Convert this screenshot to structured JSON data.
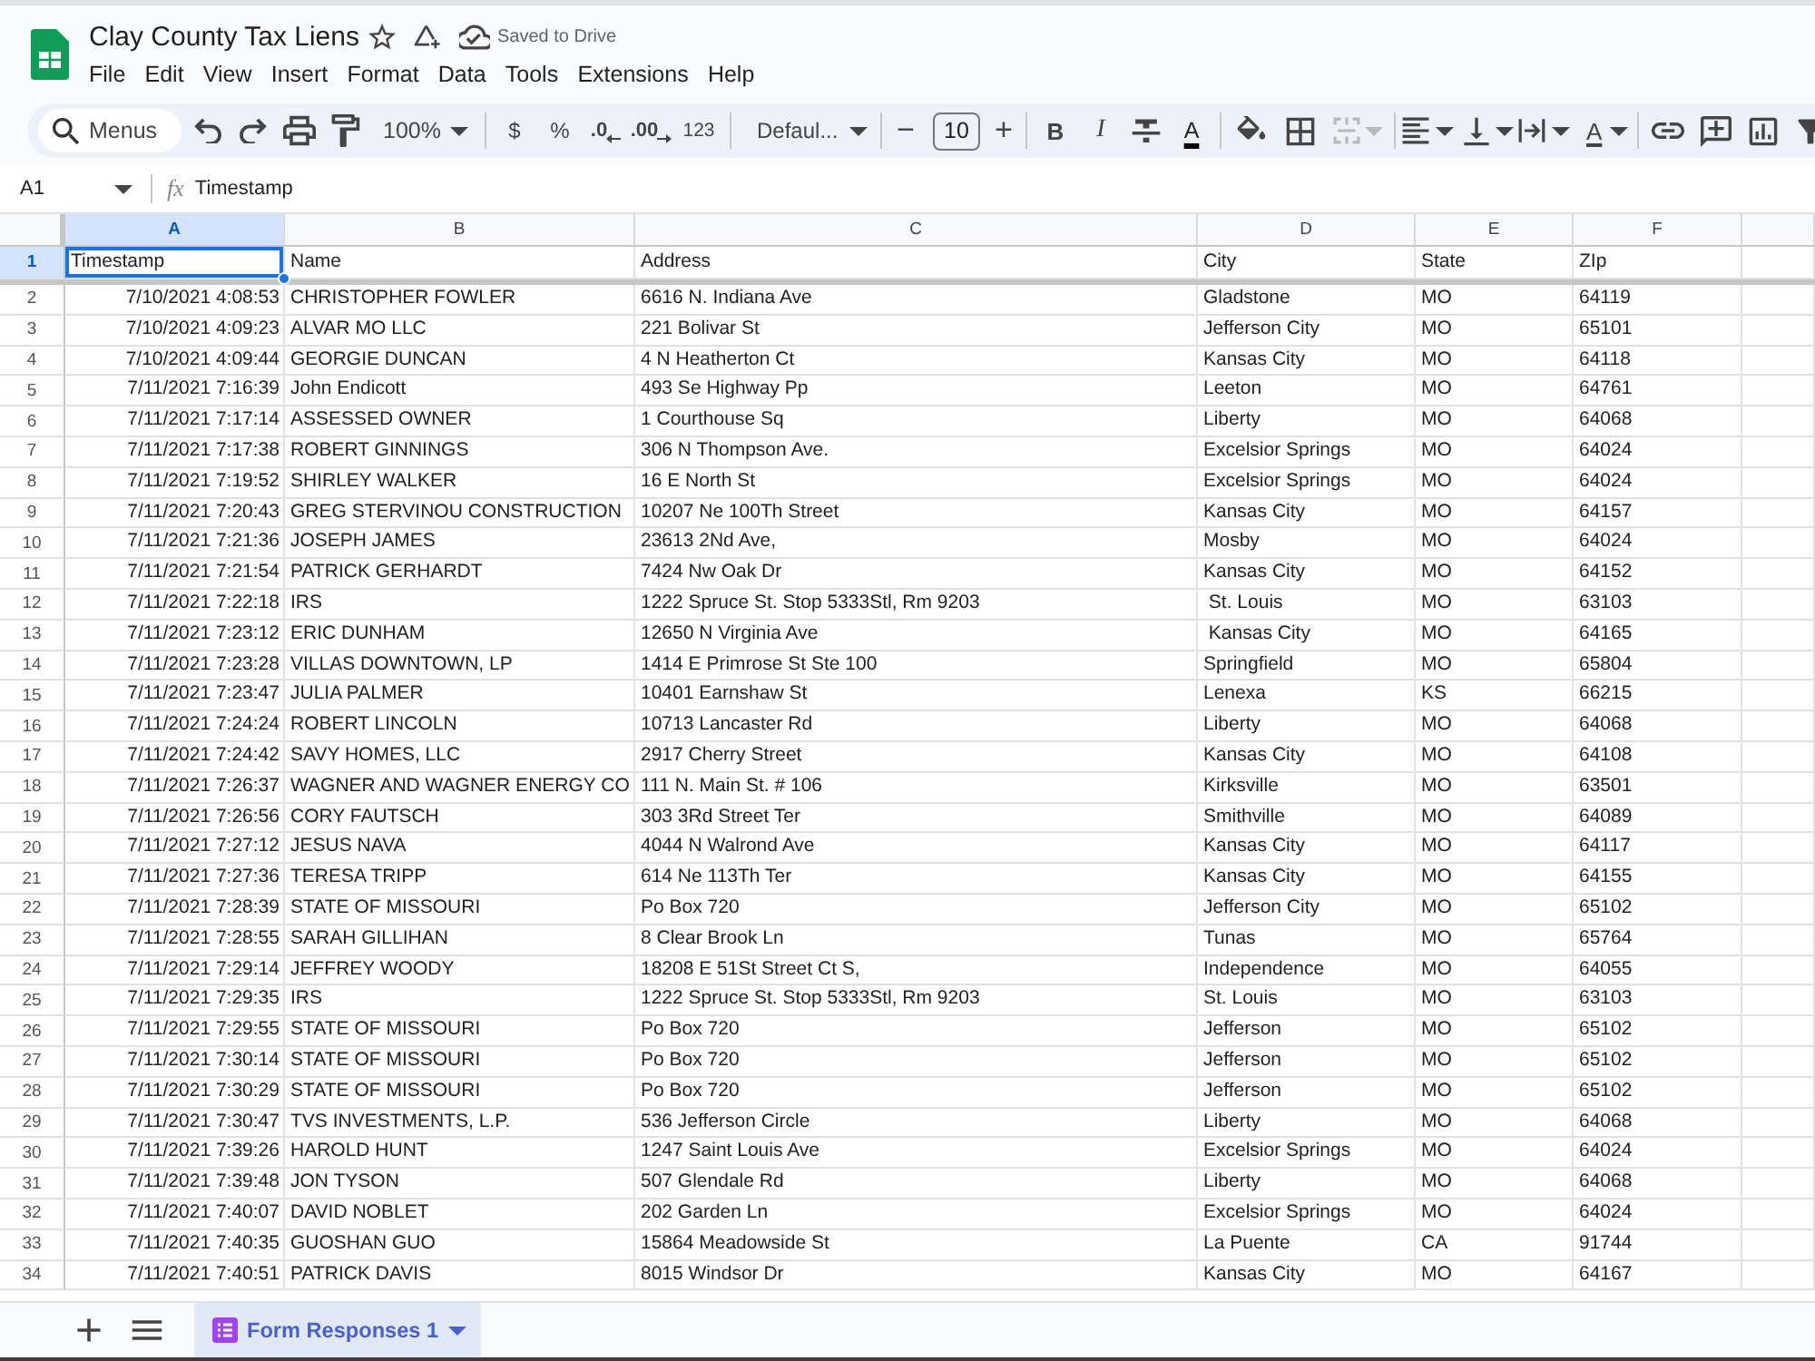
{
  "document": {
    "title": "Clay County Tax Liens",
    "save_status": "Saved to Drive"
  },
  "menu": [
    "File",
    "Edit",
    "View",
    "Insert",
    "Format",
    "Data",
    "Tools",
    "Extensions",
    "Help"
  ],
  "toolbar": {
    "search": {
      "placeholder": "Menus"
    },
    "zoom": "100%",
    "number_formats": [
      {
        "label": "$",
        "kind": "currency"
      },
      {
        "label": "%",
        "kind": "percent"
      },
      {
        "label": ".0",
        "kind": "decrease-decimal"
      },
      {
        "label": ".00",
        "kind": "increase-decimal"
      },
      {
        "label": "123",
        "kind": "more-formats"
      }
    ],
    "font": "Defaul...",
    "size_down": "−",
    "font_size": "10",
    "size_up": "+",
    "bold": "B",
    "italic": "I",
    "text_color": "A",
    "merge": {
      "disabled": true
    },
    "text_rotation": "A"
  },
  "formula_bar": {
    "cell_ref": "A1",
    "fx": "fx",
    "value": "Timestamp"
  },
  "sheet": {
    "columns": [
      {
        "label": "A",
        "selected": true
      },
      {
        "label": "B",
        "selected": false
      },
      {
        "label": "C",
        "selected": false
      },
      {
        "label": "D",
        "selected": false
      },
      {
        "label": "E",
        "selected": false
      },
      {
        "label": "F",
        "selected": false
      }
    ],
    "rows": [
      {
        "number": "1",
        "selected": true,
        "cells": [
          "Timestamp",
          "Name",
          "Address",
          "City",
          "State",
          "ZIp"
        ]
      },
      {
        "number": "2",
        "selected": false,
        "cells": [
          "7/10/2021 4:08:53",
          "CHRISTOPHER FOWLER",
          "6616 N. Indiana Ave",
          "Gladstone",
          "MO",
          "64119"
        ]
      },
      {
        "number": "3",
        "selected": false,
        "cells": [
          "7/10/2021 4:09:23",
          "ALVAR MO LLC",
          "221 Bolivar St",
          "Jefferson City",
          "MO",
          "65101"
        ]
      },
      {
        "number": "4",
        "selected": false,
        "cells": [
          "7/10/2021 4:09:44",
          "GEORGIE DUNCAN",
          "4 N Heatherton Ct",
          "Kansas City",
          "MO",
          "64118"
        ]
      },
      {
        "number": "5",
        "selected": false,
        "cells": [
          "7/11/2021 7:16:39",
          "John Endicott",
          "493 Se Highway Pp",
          "Leeton",
          "MO",
          "64761"
        ]
      },
      {
        "number": "6",
        "selected": false,
        "cells": [
          "7/11/2021 7:17:14",
          "ASSESSED OWNER",
          "1 Courthouse Sq",
          "Liberty",
          "MO",
          "64068"
        ]
      },
      {
        "number": "7",
        "selected": false,
        "cells": [
          "7/11/2021 7:17:38",
          "ROBERT GINNINGS",
          "306 N Thompson Ave.",
          "Excelsior Springs",
          "MO",
          "64024"
        ]
      },
      {
        "number": "8",
        "selected": false,
        "cells": [
          "7/11/2021 7:19:52",
          "SHIRLEY WALKER",
          "16 E North St",
          "Excelsior Springs",
          "MO",
          "64024"
        ]
      },
      {
        "number": "9",
        "selected": false,
        "cells": [
          "7/11/2021 7:20:43",
          "GREG STERVINOU CONSTRUCTION",
          "10207 Ne 100Th Street",
          "Kansas City",
          "MO",
          "64157"
        ]
      },
      {
        "number": "10",
        "selected": false,
        "cells": [
          "7/11/2021 7:21:36",
          "JOSEPH JAMES",
          "23613 2Nd Ave,",
          "Mosby",
          "MO",
          "64024"
        ]
      },
      {
        "number": "11",
        "selected": false,
        "cells": [
          "7/11/2021 7:21:54",
          "PATRICK GERHARDT",
          "7424 Nw Oak Dr",
          "Kansas City",
          "MO",
          "64152"
        ]
      },
      {
        "number": "12",
        "selected": false,
        "cells": [
          "7/11/2021 7:22:18",
          "IRS",
          "1222 Spruce St. Stop 5333Stl, Rm 9203",
          " St. Louis",
          "MO",
          "63103"
        ]
      },
      {
        "number": "13",
        "selected": false,
        "cells": [
          "7/11/2021 7:23:12",
          "ERIC DUNHAM",
          "12650 N Virginia Ave",
          " Kansas City",
          "MO",
          "64165"
        ]
      },
      {
        "number": "14",
        "selected": false,
        "cells": [
          "7/11/2021 7:23:28",
          "VILLAS DOWNTOWN, LP",
          "1414 E Primrose St Ste 100",
          "Springfield",
          "MO",
          "65804"
        ]
      },
      {
        "number": "15",
        "selected": false,
        "cells": [
          "7/11/2021 7:23:47",
          "JULIA PALMER",
          "10401 Earnshaw St",
          "Lenexa",
          "KS",
          "66215"
        ]
      },
      {
        "number": "16",
        "selected": false,
        "cells": [
          "7/11/2021 7:24:24",
          "ROBERT LINCOLN",
          "10713 Lancaster Rd",
          "Liberty",
          "MO",
          "64068"
        ]
      },
      {
        "number": "17",
        "selected": false,
        "cells": [
          "7/11/2021 7:24:42",
          "SAVY HOMES, LLC",
          "2917 Cherry Street",
          "Kansas City",
          "MO",
          "64108"
        ]
      },
      {
        "number": "18",
        "selected": false,
        "cells": [
          "7/11/2021 7:26:37",
          "WAGNER AND WAGNER ENERGY CO",
          "111 N. Main St. # 106",
          "Kirksville",
          "MO",
          "63501"
        ]
      },
      {
        "number": "19",
        "selected": false,
        "cells": [
          "7/11/2021 7:26:56",
          "CORY FAUTSCH",
          "303 3Rd Street Ter",
          "Smithville",
          "MO",
          "64089"
        ]
      },
      {
        "number": "20",
        "selected": false,
        "cells": [
          "7/11/2021 7:27:12",
          "JESUS NAVA",
          "4044 N Walrond Ave",
          "Kansas City",
          "MO",
          "64117"
        ]
      },
      {
        "number": "21",
        "selected": false,
        "cells": [
          "7/11/2021 7:27:36",
          "TERESA TRIPP",
          "614 Ne 113Th Ter",
          "Kansas City",
          "MO",
          "64155"
        ]
      },
      {
        "number": "22",
        "selected": false,
        "cells": [
          "7/11/2021 7:28:39",
          "STATE OF MISSOURI",
          "Po Box 720",
          "Jefferson City",
          "MO",
          "65102"
        ]
      },
      {
        "number": "23",
        "selected": false,
        "cells": [
          "7/11/2021 7:28:55",
          "SARAH GILLIHAN",
          "8 Clear Brook Ln",
          "Tunas",
          "MO",
          "65764"
        ]
      },
      {
        "number": "24",
        "selected": false,
        "cells": [
          "7/11/2021 7:29:14",
          "JEFFREY WOODY",
          "18208 E 51St Street Ct S,",
          "Independence",
          "MO",
          "64055"
        ]
      },
      {
        "number": "25",
        "selected": false,
        "cells": [
          "7/11/2021 7:29:35",
          "IRS",
          "1222 Spruce St. Stop 5333Stl, Rm 9203",
          "St. Louis",
          "MO",
          "63103"
        ]
      },
      {
        "number": "26",
        "selected": false,
        "cells": [
          "7/11/2021 7:29:55",
          "STATE OF MISSOURI",
          "Po Box 720",
          "Jefferson",
          "MO",
          "65102"
        ]
      },
      {
        "number": "27",
        "selected": false,
        "cells": [
          "7/11/2021 7:30:14",
          "STATE OF MISSOURI",
          "Po Box 720",
          "Jefferson",
          "MO",
          "65102"
        ]
      },
      {
        "number": "28",
        "selected": false,
        "cells": [
          "7/11/2021 7:30:29",
          "STATE OF MISSOURI",
          "Po Box 720",
          "Jefferson",
          "MO",
          "65102"
        ]
      },
      {
        "number": "29",
        "selected": false,
        "cells": [
          "7/11/2021 7:30:47",
          "TVS INVESTMENTS, L.P.",
          "536 Jefferson Circle",
          "Liberty",
          "MO",
          "64068"
        ]
      },
      {
        "number": "30",
        "selected": false,
        "cells": [
          "7/11/2021 7:39:26",
          "HAROLD HUNT",
          "1247 Saint Louis Ave",
          "Excelsior Springs",
          "MO",
          "64024"
        ]
      },
      {
        "number": "31",
        "selected": false,
        "cells": [
          "7/11/2021 7:39:48",
          "JON TYSON",
          "507 Glendale Rd",
          "Liberty",
          "MO",
          "64068"
        ]
      },
      {
        "number": "32",
        "selected": false,
        "cells": [
          "7/11/2021 7:40:07",
          "DAVID NOBLET",
          "202 Garden Ln",
          "Excelsior Springs",
          "MO",
          "64024"
        ]
      },
      {
        "number": "33",
        "selected": false,
        "cells": [
          "7/11/2021 7:40:35",
          "GUOSHAN GUO",
          "15864 Meadowside St",
          "La Puente",
          "CA",
          "91744"
        ]
      },
      {
        "number": "34",
        "selected": false,
        "cells": [
          "7/11/2021 7:40:51",
          "PATRICK DAVIS",
          "8015 Windsor Dr",
          "Kansas City",
          "MO",
          "64167"
        ]
      }
    ]
  },
  "sheets": [
    {
      "name": "Form Responses 1",
      "selected": true
    }
  ]
}
